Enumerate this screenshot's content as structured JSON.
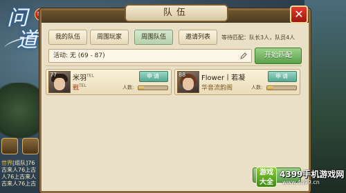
{
  "logo": {
    "text_line1": "问",
    "text_line2": "道",
    "badge": "手游"
  },
  "chat": [
    {
      "tag": "世界",
      "text": "[组队]76"
    },
    {
      "tag": "",
      "text": "古来人76上古"
    },
    {
      "tag": "",
      "text": "人76上古来人"
    },
    {
      "tag": "",
      "text": "古来人76上古"
    }
  ],
  "panel": {
    "title": "队伍",
    "close_label": "✕"
  },
  "tabs": [
    {
      "label": "我的队伍",
      "active": false
    },
    {
      "label": "周围玩家",
      "active": false
    },
    {
      "label": "周围队伍",
      "active": true
    },
    {
      "label": "邀请列表",
      "active": false
    }
  ],
  "wait_info": "等待匹配：队长3人，队员4人",
  "activity": {
    "label": "活动: 无 (69 - 87)"
  },
  "start_button": "开始匹配",
  "teams": [
    {
      "level": "77",
      "leader": "米羽",
      "leader_suffix": "TEL",
      "sub": "戰",
      "sub_suffix": "TEL",
      "apply_label": "申请",
      "count_label": "人数:",
      "count_fraction": 0.2,
      "portrait": "male"
    },
    {
      "level": "88",
      "leader": "Flower丨若凝",
      "leader_suffix": "",
      "sub": "华音流韵阁",
      "sub_suffix": "",
      "apply_label": "申请",
      "count_label": "人数:",
      "count_fraction": 0.2,
      "portrait": "female"
    }
  ],
  "watermark": {
    "box": "游戏大全",
    "title": "4399手机游戏网",
    "url": "www.4399.cn"
  }
}
